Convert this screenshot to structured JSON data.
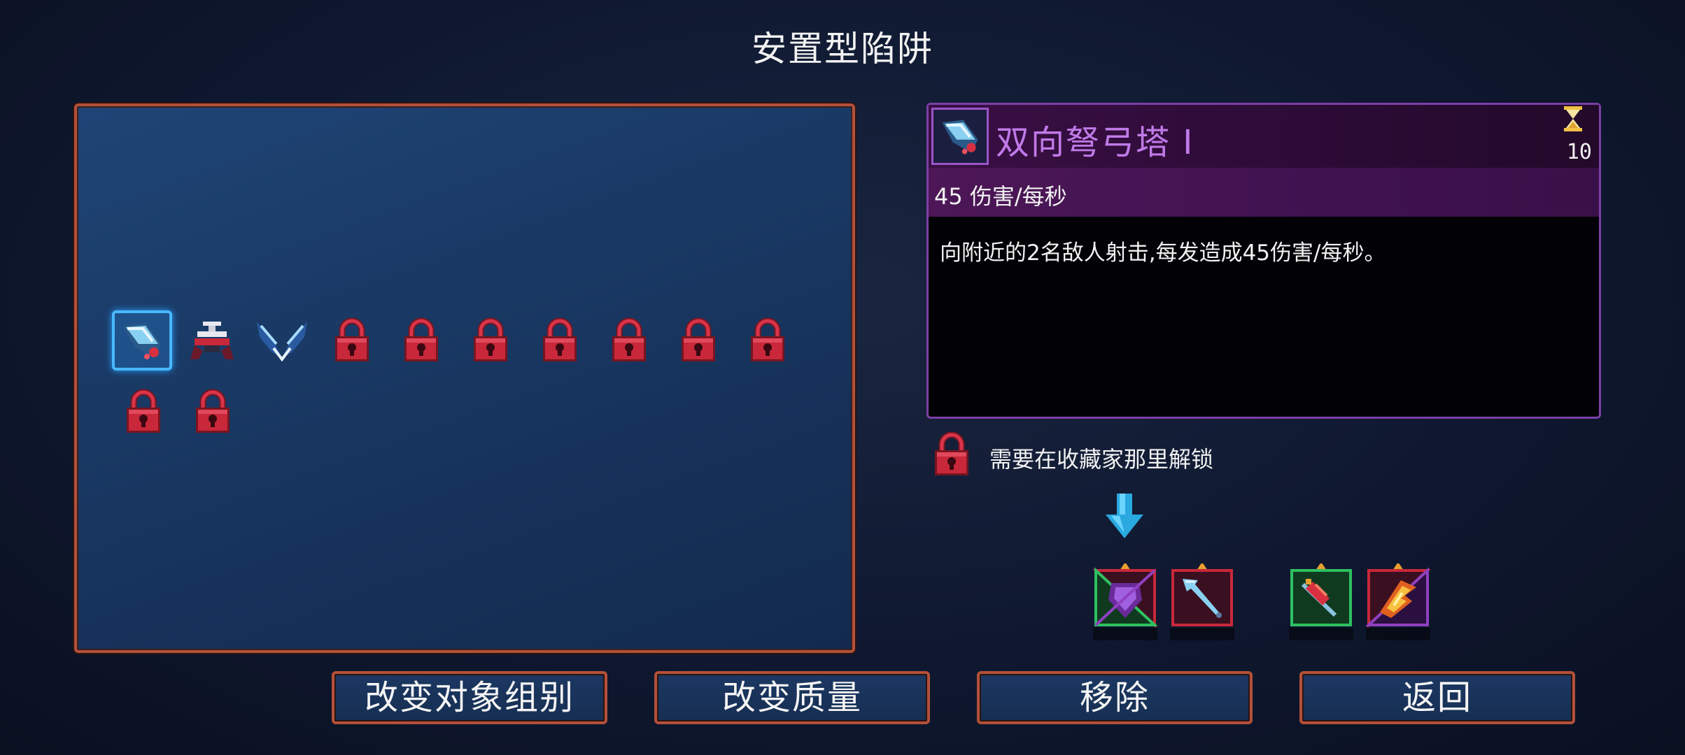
{
  "title": "安置型陷阱",
  "selected_item": {
    "name": "双向弩弓塔 Ⅰ",
    "cooldown": "10",
    "stat": "45 伤害/每秒",
    "description": "向附近的2名敌人射击,每发造成45伤害/每秒。"
  },
  "unlock_notice": "需要在收藏家那里解锁",
  "grid": {
    "row1": [
      "crossbow-turret-icon",
      "totem-trap-icon",
      "wing-blades-icon",
      "lock-icon",
      "lock-icon",
      "lock-icon",
      "lock-icon",
      "lock-icon",
      "lock-icon",
      "lock-icon"
    ],
    "row2": [
      "lock-icon",
      "lock-icon"
    ]
  },
  "scroll_slots": [
    "purple-shield-icon",
    "ice-arrow-icon",
    "bomb-icon",
    "fire-icon"
  ],
  "buttons": {
    "change_group": "改变对象组别",
    "change_quality": "改变质量",
    "remove": "移除",
    "back": "返回"
  },
  "colors": {
    "panel_border": "#b4503a",
    "selection": "#49b8ff",
    "card_border": "#7b3fa6",
    "lock_red": "#c8283a"
  }
}
